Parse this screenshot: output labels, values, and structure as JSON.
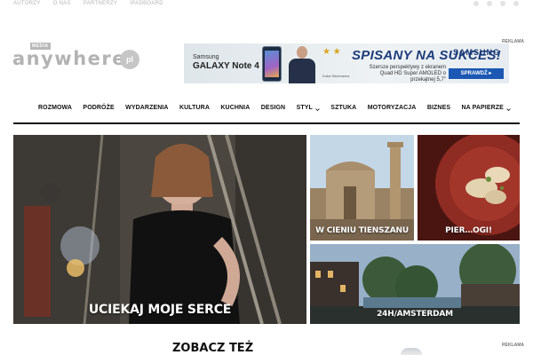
{
  "topbar": {
    "links": [
      "AUTORZY",
      "O NAS",
      "PARTNERZY",
      "IPADBOARD"
    ],
    "social_icons": [
      "facebook-icon",
      "twitter-icon",
      "instagram-icon",
      "rss-icon"
    ]
  },
  "logo": {
    "badge": "MEDIA",
    "word": "anywhere",
    "tld": "pl"
  },
  "ad": {
    "label": "REKLAMA",
    "brand_line1": "Samsung",
    "brand_line2": "GALAXY Note 4",
    "stars": "★ ★",
    "small_text": "Kuba Siechowicz",
    "headline": "SPISANY NA SUKCES!",
    "sub": "Szersze perspektywy z ekranem Quad HD Super AMOLED o przekątnej 5,7\"",
    "samsung": "SAMSUNG",
    "cta": "SPRAWDŹ ▸"
  },
  "nav": {
    "items": [
      {
        "label": "ROZMOWA",
        "dropdown": false
      },
      {
        "label": "PODRÓŻE",
        "dropdown": false
      },
      {
        "label": "WYDARZENIA",
        "dropdown": false
      },
      {
        "label": "KULTURA",
        "dropdown": false
      },
      {
        "label": "KUCHNIA",
        "dropdown": false
      },
      {
        "label": "DESIGN",
        "dropdown": false
      },
      {
        "label": "STYL",
        "dropdown": true
      },
      {
        "label": "SZTUKA",
        "dropdown": false
      },
      {
        "label": "MOTORYZACJA",
        "dropdown": false
      },
      {
        "label": "BIZNES",
        "dropdown": false
      },
      {
        "label": "NA PAPIERZE",
        "dropdown": true
      }
    ]
  },
  "tiles": {
    "main": "UCIEKAJ MOJE SERCE",
    "a": "W CIENIU TIENSZANU",
    "b": "PIER…OGI!",
    "c": "24H/AMSTERDAM"
  },
  "below": {
    "see_also": "ZOBACZ TEŻ",
    "ad_label": "REKLAMA"
  }
}
